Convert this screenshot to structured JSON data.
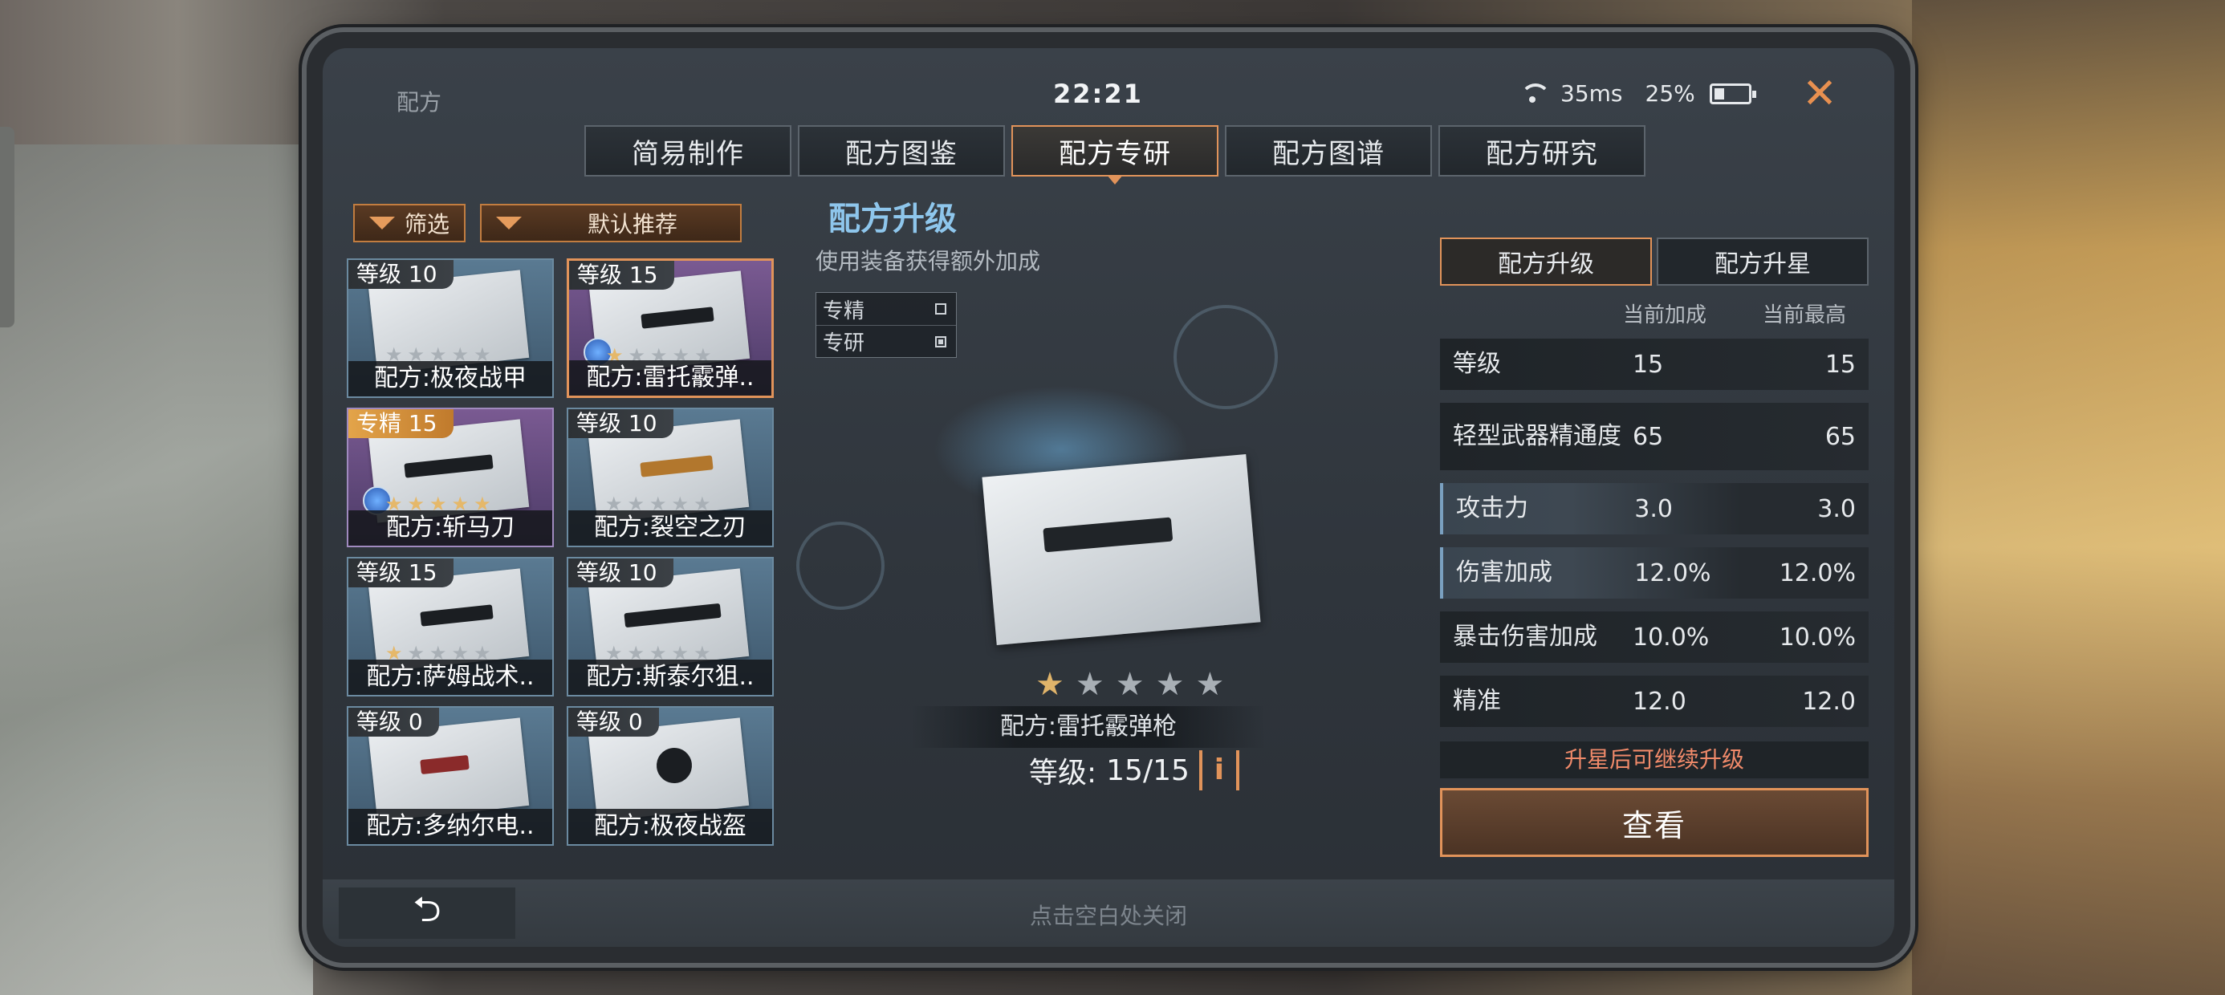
{
  "status": {
    "title": "配方",
    "time": "22:21",
    "ping": "35ms",
    "battery": "25%"
  },
  "tabs": [
    {
      "label": "简易制作",
      "active": false
    },
    {
      "label": "配方图鉴",
      "active": false
    },
    {
      "label": "配方专研",
      "active": true
    },
    {
      "label": "配方图谱",
      "active": false
    },
    {
      "label": "配方研究",
      "active": false
    }
  ],
  "filters": {
    "filter_label": "筛选",
    "sort_label": "默认推荐"
  },
  "cards": [
    {
      "level": "等级 10",
      "name": "配方:极夜战甲",
      "stars": 0,
      "gold": false
    },
    {
      "level": "等级 15",
      "name": "配方:雷托霰弹..",
      "stars": 1,
      "gold": false,
      "selected": true
    },
    {
      "level": "专精 15",
      "name": "配方:斩马刀",
      "stars": 5,
      "gold": true
    },
    {
      "level": "等级 10",
      "name": "配方:裂空之刃",
      "stars": 0,
      "gold": false
    },
    {
      "level": "等级 15",
      "name": "配方:萨姆战术..",
      "stars": 1,
      "gold": false
    },
    {
      "level": "等级 10",
      "name": "配方:斯泰尔狙..",
      "stars": 0,
      "gold": false
    },
    {
      "level": "等级 0",
      "name": "配方:多纳尔电..",
      "stars": 0,
      "gold": false
    },
    {
      "level": "等级 0",
      "name": "配方:极夜战盔",
      "stars": 0,
      "gold": false
    }
  ],
  "center": {
    "title": "配方升级",
    "subtitle": "使用装备获得额外加成",
    "legend": [
      {
        "label": "专精",
        "checked": false
      },
      {
        "label": "专研",
        "checked": true
      }
    ],
    "item_name": "配方:雷托霰弹枪",
    "stars_on": 1,
    "stars_total": 5,
    "level_label": "等级:",
    "level_value": "15/15",
    "info_glyph": "i"
  },
  "right": {
    "tabs": [
      {
        "label": "配方升级",
        "active": true
      },
      {
        "label": "配方升星",
        "active": false
      }
    ],
    "head_current": "当前加成",
    "head_max": "当前最高",
    "stats": [
      {
        "name": "等级",
        "current": "15",
        "max": "15"
      },
      {
        "name": "轻型武器精通度",
        "current": "65",
        "max": "65"
      },
      {
        "name": "攻击力",
        "current": "3.0",
        "max": "3.0"
      },
      {
        "name": "伤害加成",
        "current": "12.0%",
        "max": "12.0%"
      },
      {
        "name": "暴击伤害加成",
        "current": "10.0%",
        "max": "10.0%"
      },
      {
        "name": "精准",
        "current": "12.0",
        "max": "12.0"
      }
    ],
    "note": "升星后可继续升级",
    "view_button": "查看"
  },
  "bottom": {
    "back_glyph": "⮌",
    "close_hint": "点击空白处关闭"
  },
  "colors": {
    "accent": "#e1935a",
    "title_blue": "#8ec6ec",
    "note_red": "#f08a6a"
  }
}
